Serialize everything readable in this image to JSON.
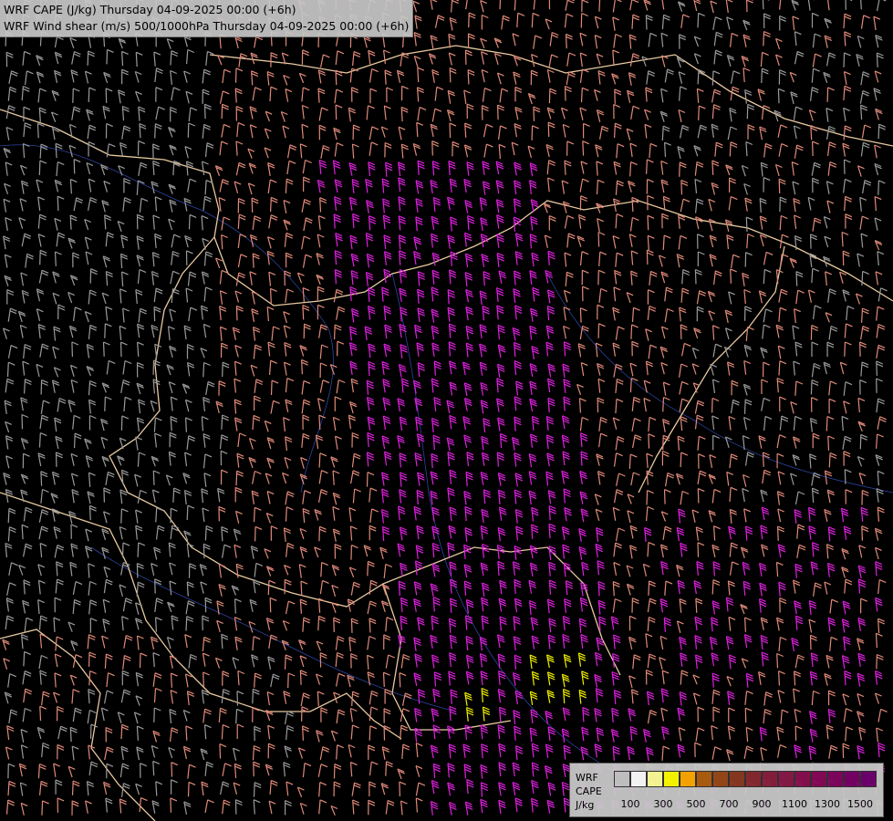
{
  "map": {
    "title_line1": "WRF CAPE (J/kg) Thursday 04-09-2025 00:00 (+6h)",
    "title_line2": "WRF Wind shear (m/s) 500/1000hPa Thursday 04-09-2025 00:00 (+6h)",
    "colors": {
      "background": "#000000",
      "border": "#e8c9a0",
      "river": "#3a55c8",
      "barb_low": "#9a9a9a",
      "barb_mid": "#e08a7a",
      "barb_high": "#e020e0",
      "barb_extreme": "#f0f000"
    }
  },
  "legend": {
    "label_line1": "WRF",
    "label_line2": "CAPE",
    "label_line3": "J/kg",
    "tick_labels": [
      "100",
      "300",
      "500",
      "700",
      "900",
      "1100",
      "1300",
      "1500"
    ],
    "swatch_colors": [
      "#c8c8c8",
      "#ffffff",
      "#ffff99",
      "#ffff00",
      "#ffaa00",
      "#b06010",
      "#9a4a1a",
      "#8c3a22",
      "#8a2a30",
      "#8a2040",
      "#8a1a48",
      "#8a1050",
      "#880a58",
      "#820660",
      "#7a0068",
      "#700070"
    ]
  }
}
